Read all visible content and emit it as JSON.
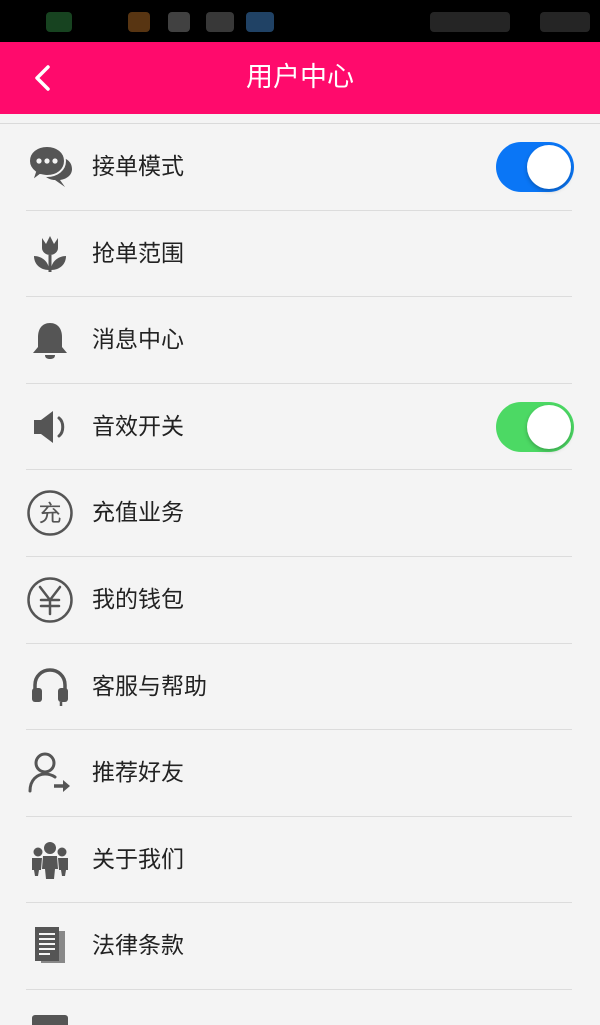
{
  "header": {
    "title": "用户中心"
  },
  "menu": {
    "items": [
      {
        "label": "接单模式",
        "icon": "chat-bubbles-icon",
        "toggle": {
          "on": true,
          "color": "#0a76f6"
        }
      },
      {
        "label": "抢单范围",
        "icon": "tulip-icon"
      },
      {
        "label": "消息中心",
        "icon": "bell-icon"
      },
      {
        "label": "音效开关",
        "icon": "speaker-icon",
        "toggle": {
          "on": true,
          "color": "#4cd964"
        }
      },
      {
        "label": "充值业务",
        "icon": "recharge-icon",
        "icon_text": "充"
      },
      {
        "label": "我的钱包",
        "icon": "yuan-icon",
        "icon_text": "¥"
      },
      {
        "label": "客服与帮助",
        "icon": "headset-icon"
      },
      {
        "label": "推荐好友",
        "icon": "user-arrow-icon"
      },
      {
        "label": "关于我们",
        "icon": "group-icon"
      },
      {
        "label": "法律条款",
        "icon": "document-icon"
      }
    ]
  },
  "colors": {
    "header": "#ff0a6c",
    "icon": "#555555",
    "background": "#f4f4f4"
  }
}
